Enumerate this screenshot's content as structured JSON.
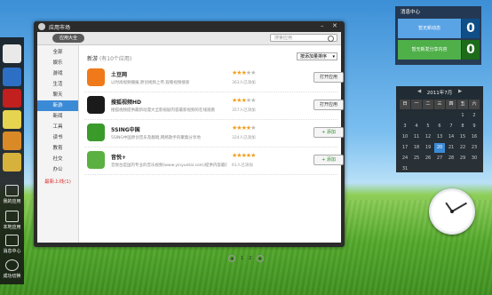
{
  "window": {
    "title": "应用市场",
    "toolbar": {
      "all_apps_button": "应用大全",
      "search_placeholder": "搜索应用"
    }
  },
  "sidebar": {
    "items": [
      {
        "label": "全部"
      },
      {
        "label": "娱乐"
      },
      {
        "label": "游戏"
      },
      {
        "label": "生活"
      },
      {
        "label": "聊天"
      },
      {
        "label": "新游"
      },
      {
        "label": "新闻"
      },
      {
        "label": "工具"
      },
      {
        "label": "读书"
      },
      {
        "label": "教育"
      },
      {
        "label": "社交"
      },
      {
        "label": "办公"
      },
      {
        "label": "最新上线(1)"
      }
    ],
    "active_index": 5
  },
  "content": {
    "title": "新游",
    "count_text": "(有10个应用)",
    "sort_label": "按添加量排序",
    "apps": [
      {
        "name": "土豆网",
        "desc": "以时尚视频播报,原创视频上传,观看视频搜索",
        "rating": 3,
        "count": "363人已添加",
        "action": "打开应用",
        "action_type": "open",
        "icon_color": "#f07a1a"
      },
      {
        "name": "搜狐视频HD",
        "desc": "搜狐视频提供最新动漫大全影视剧内容最新视频的在线观看",
        "rating": 3,
        "count": "357人已添加",
        "action": "打开应用",
        "action_type": "open",
        "icon_color": "#1a1a1a"
      },
      {
        "name": "5SING中国",
        "desc": "5SING中国原创音乐及翻唱,网络歌手的聚集分享地",
        "rating": 4,
        "count": "324人已添加",
        "action": "+ 添加",
        "action_type": "add",
        "icon_color": "#3a9a2a"
      },
      {
        "name": "音悦+",
        "desc": "音悦台是国内专业的音乐视频(www.yinyuetai.com)提供内容最新音乐",
        "rating": 5,
        "count": "61人已添加",
        "action": "+ 添加",
        "action_type": "add",
        "icon_color": "#5ab040"
      }
    ],
    "pager": {
      "pages": [
        "1",
        "2"
      ]
    }
  },
  "dock": {
    "labels": [
      "我的应用",
      "本地应用",
      "消息中心",
      "成功切换"
    ]
  },
  "message_center": {
    "title": "消息中心",
    "items": [
      {
        "label": "暂无新动态",
        "count": "0"
      },
      {
        "label": "暂无新发分享内容",
        "count": "0"
      }
    ]
  },
  "calendar": {
    "header": "2011年7月",
    "weekdays": [
      "日",
      "一",
      "二",
      "三",
      "四",
      "五",
      "六"
    ],
    "days": [
      "",
      "",
      "",
      "",
      "",
      "1",
      "2",
      "3",
      "4",
      "5",
      "6",
      "7",
      "8",
      "9",
      "10",
      "11",
      "12",
      "13",
      "14",
      "15",
      "16",
      "17",
      "18",
      "19",
      "20",
      "21",
      "22",
      "23",
      "24",
      "25",
      "26",
      "27",
      "28",
      "29",
      "30",
      "31"
    ],
    "today": "20"
  },
  "colors": {
    "accent": "#3b8ad6",
    "star": "#f0a020",
    "add": "#2a8a2a"
  }
}
